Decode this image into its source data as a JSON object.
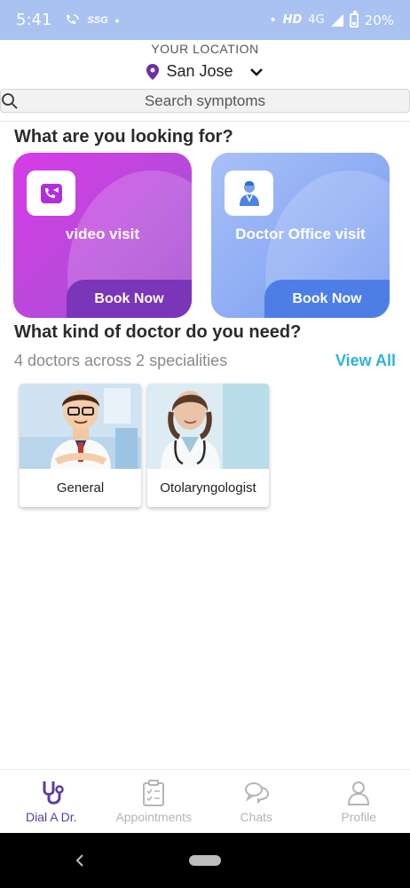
{
  "status_bar": {
    "time": "5:41",
    "left_icons": [
      "phone-wifi-icon",
      "ssg-icon",
      "dot-icon"
    ],
    "network": "HD",
    "signal_label": "4G",
    "battery": "20%"
  },
  "location": {
    "caption": "YOUR LOCATION",
    "city": "San Jose"
  },
  "search": {
    "placeholder": "Search symptoms"
  },
  "looking_for": {
    "title": "What are you looking for?",
    "cards": [
      {
        "label": "video visit",
        "button": "Book Now",
        "icon": "video-call-icon",
        "color": "#d93be8"
      },
      {
        "label": "Doctor Office visit",
        "button": "Book Now",
        "icon": "doctor-icon",
        "color": "#8aaaf4"
      }
    ]
  },
  "doctors": {
    "title": "What kind of doctor do you need?",
    "subtitle": "4 doctors across 2 specialities",
    "view_all": "View All",
    "tiles": [
      {
        "name": "General"
      },
      {
        "name": "Otolaryngologist"
      }
    ]
  },
  "bottom_nav": {
    "items": [
      {
        "label": "Dial A Dr.",
        "icon": "stethoscope-icon",
        "active": true
      },
      {
        "label": "Appointments",
        "icon": "clipboard-icon",
        "active": false
      },
      {
        "label": "Chats",
        "icon": "chat-bubbles-icon",
        "active": false
      },
      {
        "label": "Profile",
        "icon": "person-icon",
        "active": false
      }
    ]
  },
  "colors": {
    "accent": "#5b3ea0",
    "video_button": "#7a35b8",
    "office_button": "#4d7ee6",
    "view_all": "#2fb3d6",
    "status_bar": "#a9c2f2"
  }
}
